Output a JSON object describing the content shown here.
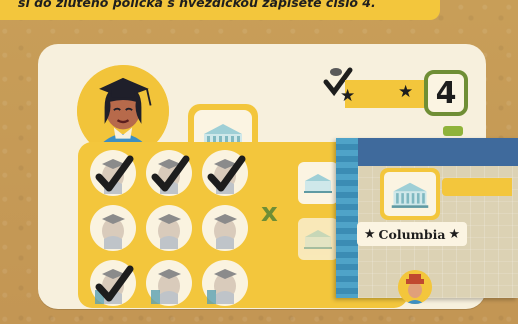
{
  "instruction": "si do zlutého políčka s hvězdičkou zapíšete číslo 4.",
  "player": {
    "avatar_icon": "graduate-avatar-icon"
  },
  "score": {
    "value": "4",
    "stars": [
      "★",
      "★"
    ]
  },
  "bonus_card": {
    "name": "Columbia",
    "stars": [
      "★",
      "★"
    ]
  },
  "tokens": [
    {
      "checked": true
    },
    {
      "checked": true
    },
    {
      "checked": true
    },
    {
      "checked": false
    },
    {
      "checked": false
    },
    {
      "checked": false
    },
    {
      "checked": true
    },
    {
      "checked": false
    },
    {
      "checked": false
    }
  ],
  "x_mark": "x",
  "colors": {
    "yellow": "#f3c63c",
    "cream": "#f7f0dd",
    "green": "#6f8e35",
    "blue": "#3f70a8"
  }
}
